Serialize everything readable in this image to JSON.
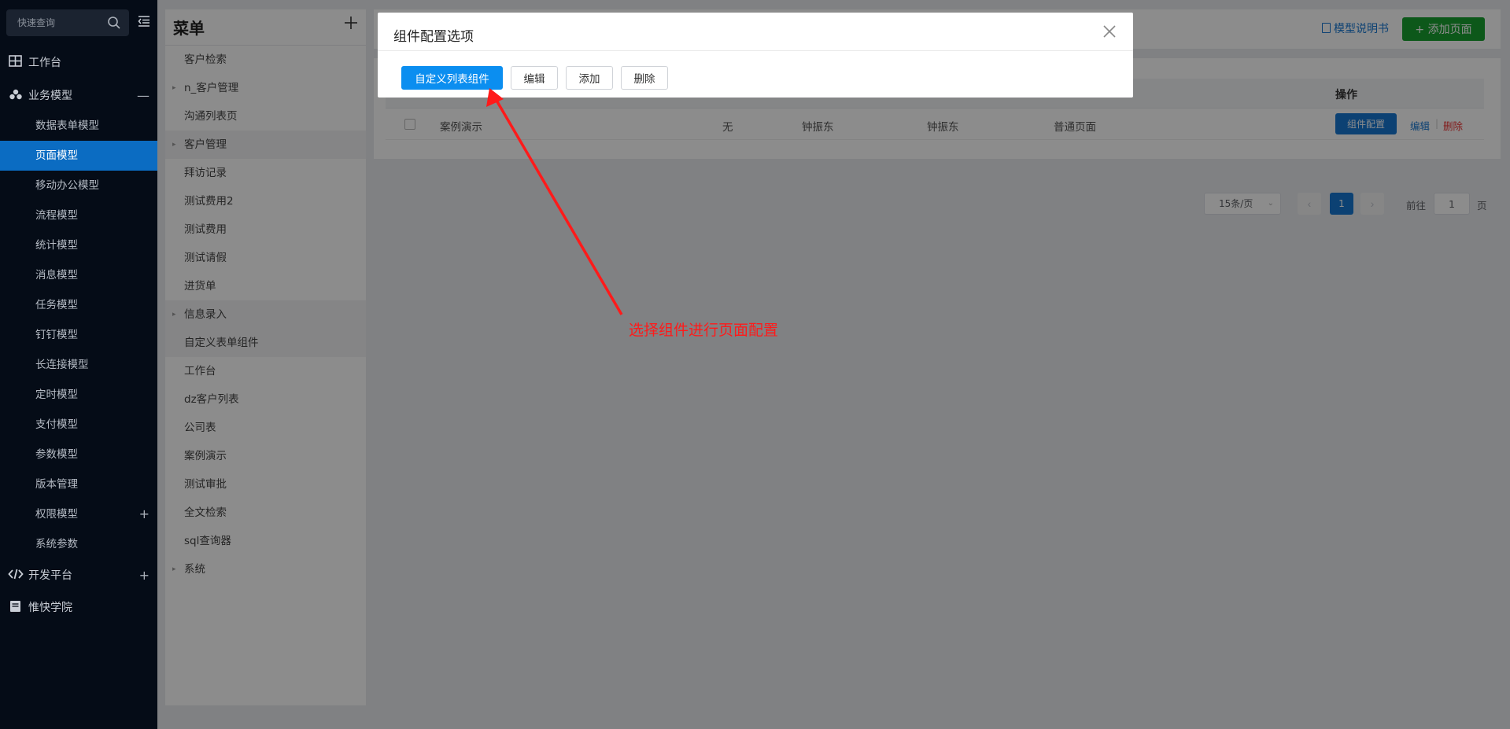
{
  "sidebar": {
    "search_placeholder": "快速查询",
    "items": [
      {
        "label": "工作台",
        "icon": "grid-icon"
      },
      {
        "label": "业务模型",
        "icon": "cubes-icon",
        "mark": "—"
      },
      {
        "label": "数据表单模型"
      },
      {
        "label": "页面模型"
      },
      {
        "label": "移动办公模型"
      },
      {
        "label": "流程模型"
      },
      {
        "label": "统计模型"
      },
      {
        "label": "消息模型"
      },
      {
        "label": "任务模型"
      },
      {
        "label": "钉钉模型"
      },
      {
        "label": "长连接模型"
      },
      {
        "label": "定时模型"
      },
      {
        "label": "支付模型"
      },
      {
        "label": "参数模型"
      },
      {
        "label": "版本管理"
      },
      {
        "label": "权限模型",
        "mark": "+"
      },
      {
        "label": "系统参数"
      },
      {
        "label": "开发平台",
        "icon": "code-icon",
        "mark": "+"
      },
      {
        "label": "惟快学院",
        "icon": "book-icon"
      }
    ]
  },
  "menu": {
    "title": "菜单",
    "items": [
      {
        "label": "客户检索"
      },
      {
        "label": "n_客户管理",
        "caret": "▸"
      },
      {
        "label": "沟通列表页"
      },
      {
        "label": "客户管理",
        "caret": "▸"
      },
      {
        "label": "拜访记录"
      },
      {
        "label": "测试费用2"
      },
      {
        "label": "测试费用"
      },
      {
        "label": "测试请假"
      },
      {
        "label": "进货单"
      },
      {
        "label": "信息录入",
        "caret": "▸"
      },
      {
        "label": "自定义表单组件"
      },
      {
        "label": "工作台"
      },
      {
        "label": "dz客户列表"
      },
      {
        "label": "公司表"
      },
      {
        "label": "案例演示"
      },
      {
        "label": "测试审批"
      },
      {
        "label": "全文检索"
      },
      {
        "label": "sql查询器"
      },
      {
        "label": "系统",
        "caret": "▸"
      }
    ]
  },
  "header": {
    "manual_link": "模型说明书",
    "add_page_button": "+ 添加页面"
  },
  "table": {
    "ops_header": "操作",
    "row": {
      "name": "案例演示",
      "col2": "无",
      "creator": "钟振东",
      "modifier": "钟振东",
      "type": "普通页面",
      "config_button": "组件配置",
      "edit": "编辑",
      "sep": "|",
      "delete": "删除"
    }
  },
  "pagination": {
    "page_size": "15条/页",
    "prev": "‹",
    "current": "1",
    "next": "›",
    "goto_label": "前往",
    "goto_value": "1",
    "page_suffix": "页"
  },
  "modal": {
    "title": "组件配置选项",
    "buttons": {
      "custom_list": "自定义列表组件",
      "edit": "编辑",
      "add": "添加",
      "delete": "删除"
    }
  },
  "annotation": {
    "text": "选择组件进行页面配置",
    "color": "#ff1a1a"
  },
  "colors": {
    "sidebar_bg": "#050c17",
    "active_item": "#0b6cc2",
    "primary_blue": "#1677d2",
    "green_button": "#19a130",
    "modal_primary": "#0b8ef0"
  }
}
